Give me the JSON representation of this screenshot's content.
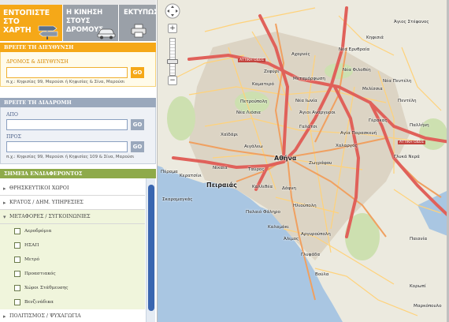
{
  "tabs": [
    {
      "label_line1": "ΕΝΤΟΠΙΣΤΕ ΣΤΟ",
      "label_line2": "ΧΑΡΤΗ",
      "icon": "signpost-icon"
    },
    {
      "label_line1": "Η ΚΙΝΗΣΗ ΣΤΟΥΣ",
      "label_line2": "ΔΡΟΜΟΥΣ",
      "icon": "car-icon"
    },
    {
      "label_line1": "ΕΚΤΥΠΩΣΗ",
      "label_line2": "",
      "icon": "printer-icon"
    }
  ],
  "address": {
    "header": "ΒΡΕΙΤΕ ΤΗ ΔΙΕΥΘΥΝΣΗ",
    "field_label": "ΔΡΟΜΟΣ & ΔΙΕΥΘΥΝΣΗ",
    "value": "",
    "go": "GO",
    "hint": "π.χ.: Κηφισίας 99, Μαρούσι ή Κηφισίας & Σίνα, Μαρούσι"
  },
  "route": {
    "header": "ΒΡΕΙΤΕ ΤΗ ΔΙΑΔΡΟΜΗ",
    "from_label": "ΑΠΟ",
    "from_value": "",
    "to_label": "ΠΡΟΣ",
    "to_value": "",
    "go": "GO",
    "hint": "π.χ.: Κηφισίας 99, Μαρούσι ή Κηφισίας 109 & Σίνα, Μαρούσι"
  },
  "poi": {
    "header": "ΣΗΜΕΙΑ ΕΝΔΙΑΦΕΡΟΝΤΟΣ",
    "categories": [
      {
        "label": "ΘΡΗΣΚΕΥΤΙΚΟΙ ΧΩΡΟΙ"
      },
      {
        "label": "ΚΡΑΤΟΣ / ΔΗΜ. ΥΠΗΡΕΣΙΕΣ"
      },
      {
        "label": "ΜΕΤΑΦΟΡΕΣ / ΣΥΓΚΟΙΝΩΝΙΕΣ"
      },
      {
        "label": "ΠΟΛΙΤΙΣΜΟΣ / ΨΥΧΑΓΩΓΙΑ"
      }
    ],
    "transport_items": [
      {
        "label": "Αεροδρόμια",
        "checked": false
      },
      {
        "label": "ΗΣΑΠ",
        "checked": false
      },
      {
        "label": "Μετρό",
        "checked": false
      },
      {
        "label": "Προαστιακός",
        "checked": false
      },
      {
        "label": "Χώροι Στάθμευσης",
        "checked": false
      },
      {
        "label": "Βενζινάδικα",
        "checked": false
      }
    ]
  },
  "map": {
    "colors": {
      "land": "#eceadf",
      "sea": "#a9c6e2",
      "urban": "#dcd4c4",
      "highway": "#e0615a",
      "major": "#f0a060",
      "minor": "#ffd27a",
      "park": "#cde0b0"
    },
    "places": {
      "kifisia": "Κηφισιά",
      "nea_erythraia": "Νέα Ερυθραία",
      "ag_stefanos": "Άγιος Στέφανος",
      "acharnes": "Αχαρνές",
      "zefyri": "Ζεφύρι",
      "metamorfosi": "Μεταμόρφωση",
      "nea_filothei": "Νέα Φιλοθέη",
      "kamatero": "Καματερό",
      "nea_penteli": "Νέα Πεντέλη",
      "melissia": "Μελίσσια",
      "petroupoli": "Πετρούπολη",
      "nea_ionia": "Νέα Ιωνία",
      "penteli": "Πεντέλη",
      "agioi_anargyroi": "Άγιοι Ανάργυροι",
      "nea_liosia": "Νέα Λιόσια",
      "galatsi": "Γαλάτσι",
      "gerakas": "Γέρακας",
      "chaidari": "Χαϊδάρι",
      "aigaleo": "Αιγάλεω",
      "agia_paraskevi": "Αγία Παρασκευή",
      "pallini": "Παλλήνη",
      "athina": "Αθήνα",
      "zografou": "Ζωγράφου",
      "cholargos": "Χολαργός",
      "nikaia": "Νίκαια",
      "tavros": "Ταύρος",
      "keratsini": "Κερατσίνι",
      "peiraias": "Πειραιάς",
      "kallithea": "Καλλιθέα",
      "dafni": "Δάφνη",
      "gerakas_nea": "Γλυκά Νερά",
      "palaio_faliro": "Παλαιό Φάληρο",
      "ilioupoli": "Ηλιούπολη",
      "alimos": "Άλιμος",
      "glyfada": "Γλυφάδα",
      "voula": "Βούλα",
      "kalamaki": "Καλαμάκι",
      "argyroupoli": "Αργυρούπολη",
      "perama": "Πέραμα",
      "paiania": "Παιανία",
      "koropi": "Κορωπί",
      "markopoulo": "Μαρκόπουλο",
      "skaramangas": "Σκαραμαγκάς"
    },
    "roads": {
      "attiki_odos": "ΑΤΤΙΚΗ ΟΔΟΣ",
      "attiki_odos_2": "ΑΤΤΙΚΗ ΟΔΟΣ"
    },
    "zoom": {
      "in": "+",
      "out": "−",
      "level_fraction": 0.35
    }
  }
}
